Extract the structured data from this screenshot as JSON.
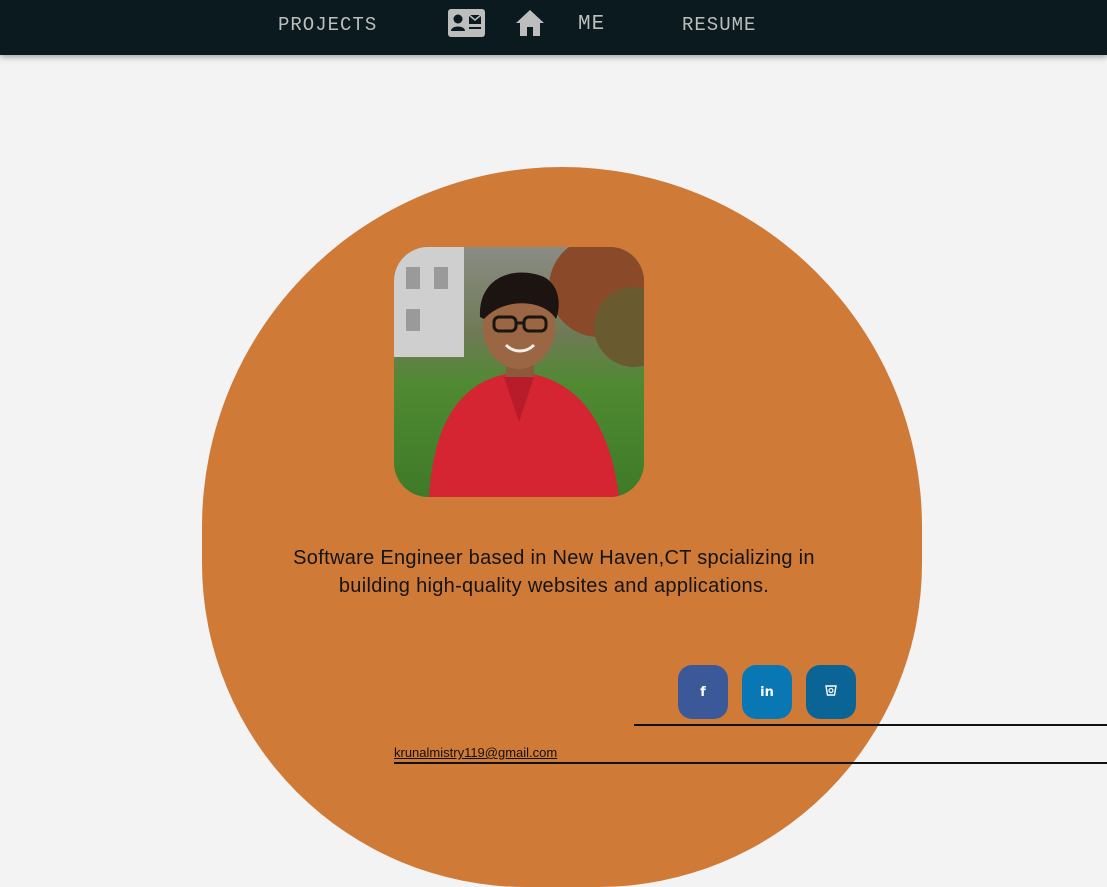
{
  "nav": {
    "projects_label": "PROJECTS",
    "me_label": "ME",
    "resume_label": "RESUME",
    "contact_icon": "contact-card-icon",
    "home_icon": "home-icon",
    "icon_color": "#bdbdbd",
    "background": "#0b1a1f"
  },
  "hero": {
    "background": "#d07a37",
    "bio": "Software Engineer based in New Haven,CT spcializing in building high-quality websites and applications."
  },
  "social": {
    "facebook": {
      "glyph": "f",
      "color": "#3b5998"
    },
    "linkedin": {
      "glyph": "in",
      "color": "#0a77b5"
    },
    "bucket": {
      "glyph": "⛉",
      "color": "#0a6496"
    }
  },
  "contact": {
    "email": "krunalmistry119@gmail.com"
  }
}
